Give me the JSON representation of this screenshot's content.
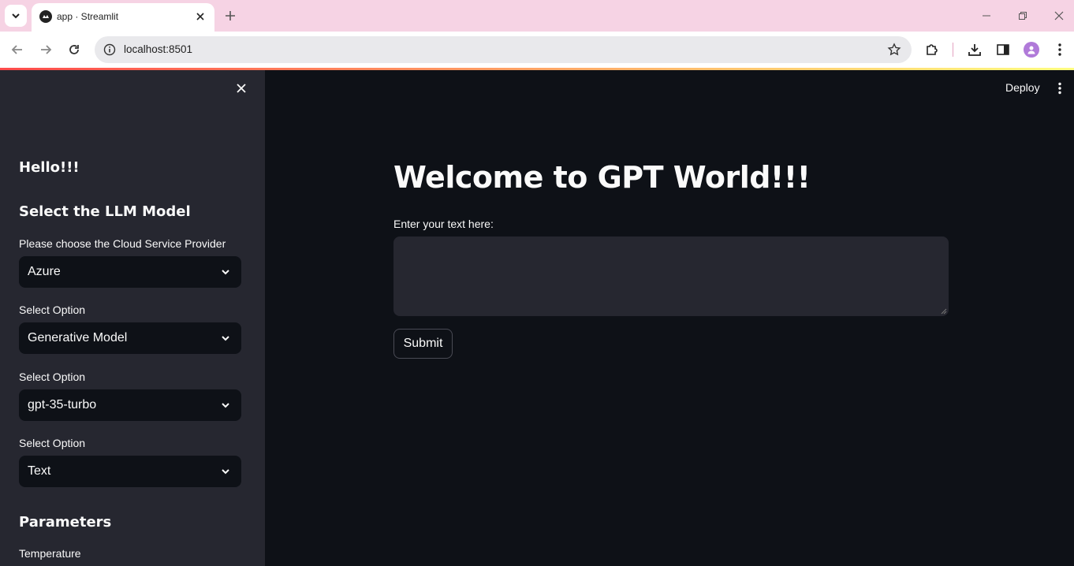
{
  "browser": {
    "tab_title": "app · Streamlit",
    "url": "localhost:8501"
  },
  "header": {
    "deploy_label": "Deploy"
  },
  "sidebar": {
    "greeting": "Hello!!!",
    "model_heading": "Select the LLM Model",
    "provider_label": "Please choose the Cloud Service Provider",
    "provider_value": "Azure",
    "option1_label": "Select Option",
    "option1_value": "Generative Model",
    "option2_label": "Select Option",
    "option2_value": "gpt-35-turbo",
    "option3_label": "Select Option",
    "option3_value": "Text",
    "parameters_heading": "Parameters",
    "temperature_label": "Temperature"
  },
  "main": {
    "title": "Welcome to GPT World!!!",
    "input_label": "Enter your text here:",
    "input_value": "",
    "submit_label": "Submit"
  },
  "colors": {
    "app_bg": "#0e1117",
    "sidebar_bg": "#262730",
    "tabbar_bg": "#f6d3e4",
    "accent": "#ff4b4b"
  }
}
